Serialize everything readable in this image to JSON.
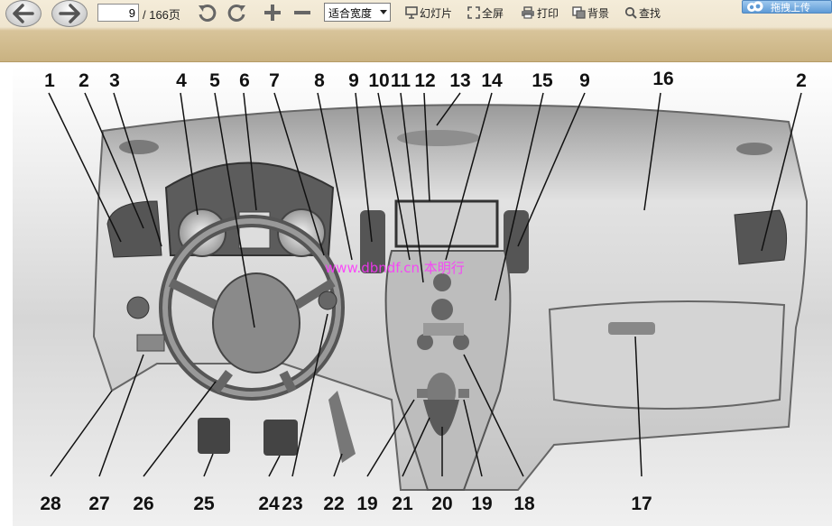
{
  "toolbar": {
    "back_icon": "arrow-left-icon",
    "forward_icon": "arrow-right-icon",
    "page_current": "9",
    "page_total": "/ 166页",
    "zoom": "适合宽度",
    "slideshow_label": "幻灯片",
    "fullscreen_label": "全屏",
    "print_label": "打印",
    "background_label": "背景",
    "find_label": "查找",
    "upload_label": "拖拽上传",
    "accent": "#c9b281"
  },
  "figure": {
    "watermark": "www.dbndf.cn  本明行",
    "callouts_top": [
      "1",
      "2",
      "3",
      "4",
      "5",
      "6",
      "7",
      "8",
      "9",
      "10",
      "11",
      "12",
      "13",
      "14",
      "15",
      "9",
      "16",
      "2"
    ],
    "callouts_bottom": [
      "28",
      "27",
      "26",
      "25",
      "24",
      "23",
      "22",
      "19",
      "21",
      "20",
      "19",
      "18",
      "17"
    ]
  }
}
